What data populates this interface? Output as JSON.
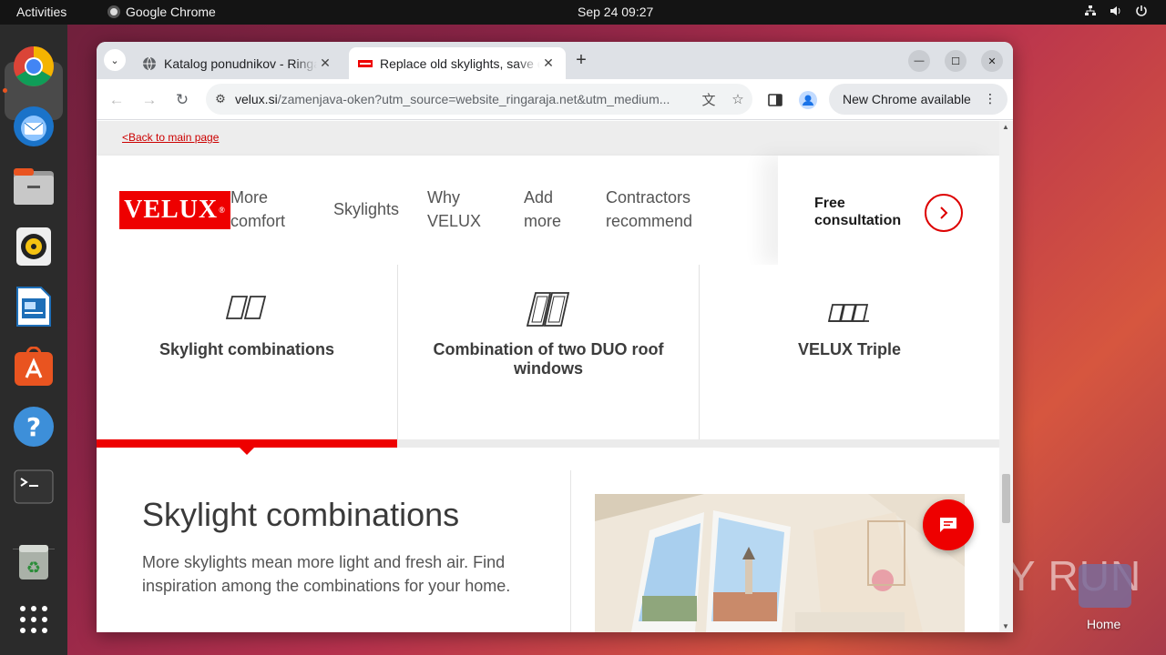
{
  "topbar": {
    "activities": "Activities",
    "app_name": "Google Chrome",
    "clock": "Sep 24  09:27",
    "tray_icons": [
      "network-icon",
      "volume-icon",
      "power-icon"
    ]
  },
  "dock": {
    "items": [
      "chrome-icon",
      "thunderbird-icon",
      "files-icon",
      "rhythmbox-icon",
      "writer-icon",
      "app-center-icon",
      "help-icon",
      "terminal-icon",
      "trash-icon",
      "app-grid-icon"
    ]
  },
  "browser": {
    "tabs": [
      {
        "title": "Katalog ponudnikov - Ringaraja",
        "icon": "globe-icon",
        "active": false
      },
      {
        "title": "Replace old skylights, save energy",
        "icon": "velux-favicon",
        "active": true
      }
    ],
    "new_tab": "+",
    "url_host": "velux.si",
    "url_rest": "/zamenjava-oken?utm_source=website_ringaraja.net&utm_medium...",
    "new_chrome_label": "New Chrome available"
  },
  "page": {
    "back_link": "<Back to main page",
    "logo": "VELUX",
    "logo_mark": "®",
    "nav": [
      {
        "line1": "More",
        "line2": "comfort"
      },
      {
        "line1": "Skylights",
        "line2": ""
      },
      {
        "line1": "Why",
        "line2": "VELUX"
      },
      {
        "line1": "Add",
        "line2": "more"
      },
      {
        "line1": "Contractors",
        "line2": "recommend"
      }
    ],
    "free_consult_1": "Free",
    "free_consult_2": "consultation",
    "tiles": [
      {
        "label": "Skylight combinations",
        "active": true
      },
      {
        "label": "Combination of two DUO roof windows",
        "active": false
      },
      {
        "label": "VELUX Triple",
        "active": false
      }
    ],
    "section_title": "Skylight combinations",
    "section_desc": "More skylights mean more light and fresh air. Find inspiration among the combinations for your home.",
    "accent_color": "#e00000"
  },
  "desktop": {
    "home_label": "Home",
    "watermark": "ANY RUN"
  }
}
